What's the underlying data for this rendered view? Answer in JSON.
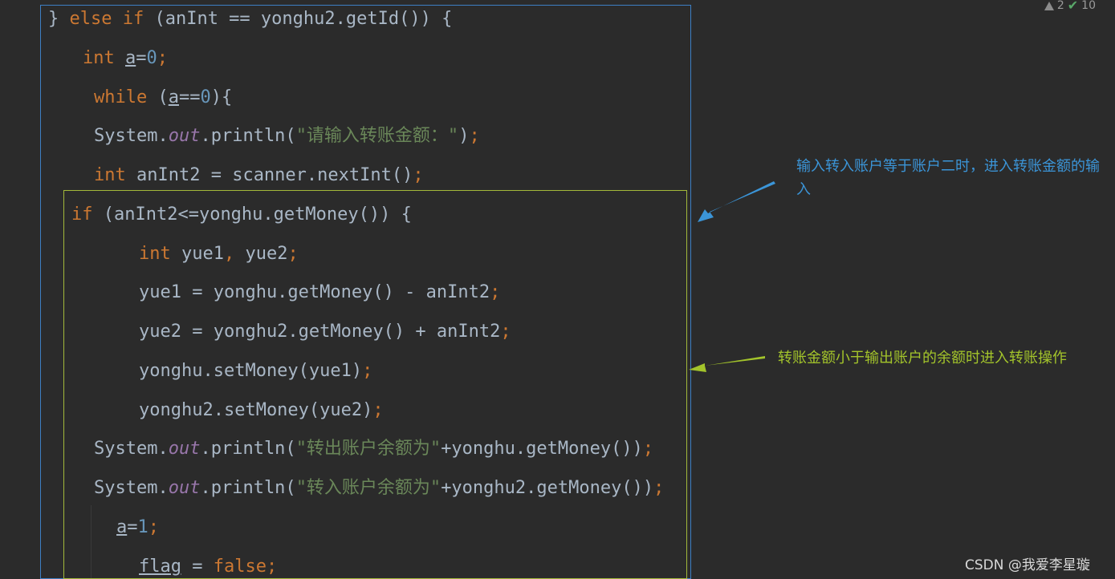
{
  "status_bar": {
    "warnings": "2",
    "checks": "10"
  },
  "code": {
    "l1": {
      "a": "} ",
      "b": "else if",
      "c": " (anInt == yonghu2.getId()) {"
    },
    "l2": {
      "a": "int",
      "b": " ",
      "c": "a",
      "d": "=",
      "e": "0",
      "f": ";"
    },
    "l3": {
      "a": "while",
      "b": " (",
      "c": "a",
      "d": "==",
      "e": "0",
      "f": "){"
    },
    "l4": {
      "a": "System.",
      "b": "out",
      "c": ".println(",
      "d": "\"请输入转账金额：\"",
      "e": ")",
      "f": ";"
    },
    "l5": {
      "a": "int",
      "b": " anInt2 = scanner.nextInt()",
      "c": ";"
    },
    "l6": {
      "a": "if",
      "b": " (anInt2<=yonghu.getMoney()) {"
    },
    "l7": {
      "a": "int",
      "b": " yue1",
      "c": ",",
      "d": " yue2",
      "e": ";"
    },
    "l8": {
      "a": "yue1 = yonghu.getMoney() - anInt2",
      "b": ";"
    },
    "l9": {
      "a": "yue2 = yonghu2.getMoney() + anInt2",
      "b": ";"
    },
    "l10": {
      "a": "yonghu.setMoney(yue1)",
      "b": ";"
    },
    "l11": {
      "a": "yonghu2.setMoney(yue2)",
      "b": ";"
    },
    "l12": {
      "a": "System.",
      "b": "out",
      "c": ".println(",
      "d": "\"转出账户余额为\"",
      "e": "+yonghu.getMoney())",
      "f": ";"
    },
    "l13": {
      "a": "System.",
      "b": "out",
      "c": ".println(",
      "d": "\"转入账户余额为\"",
      "e": "+yonghu2.getMoney())",
      "f": ";"
    },
    "l14": {
      "a": "a",
      "b": "=",
      "c": "1",
      "d": ";"
    },
    "l15": {
      "a": "flag",
      "b": " = ",
      "c": "false",
      "d": ";"
    }
  },
  "annotations": {
    "blue_note": "输入转入账户等于账户二时，进入转账金额的输入",
    "green_note": "转账金额小于输出账户的余额时进入转账操作"
  },
  "colors": {
    "blue_accent": "#3b95d8",
    "green_accent": "#a3c42b"
  },
  "watermark": "CSDN @我爱李星璇"
}
